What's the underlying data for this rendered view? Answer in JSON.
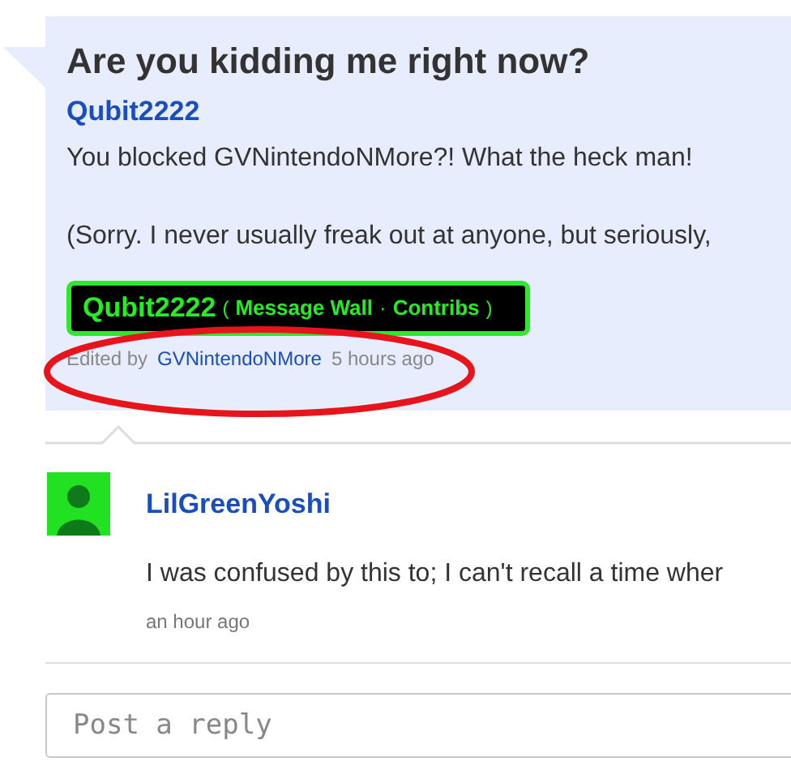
{
  "post": {
    "title": "Are you kidding me right now?",
    "author": "Qubit2222",
    "paragraphs": [
      "You blocked GVNintendoNMore?! What the heck man!",
      "(Sorry. I never usually freak out at anyone, but seriously,"
    ],
    "signature": {
      "name": "Qubit2222",
      "open": "(",
      "wall": "Message Wall",
      "separator": "·",
      "contribs": "Contribs",
      "close": ")"
    },
    "edited": {
      "label": "Edited by",
      "editor": "GVNintendoNMore",
      "time": "5 hours ago"
    },
    "annotation": {
      "kind": "ellipse",
      "color": "#e8141c"
    }
  },
  "replies": [
    {
      "author": "LilGreenYoshi",
      "text": "I was confused by this to; I can't recall a time wher",
      "time": "an hour ago"
    }
  ],
  "reply_field": {
    "placeholder": "Post a reply"
  }
}
